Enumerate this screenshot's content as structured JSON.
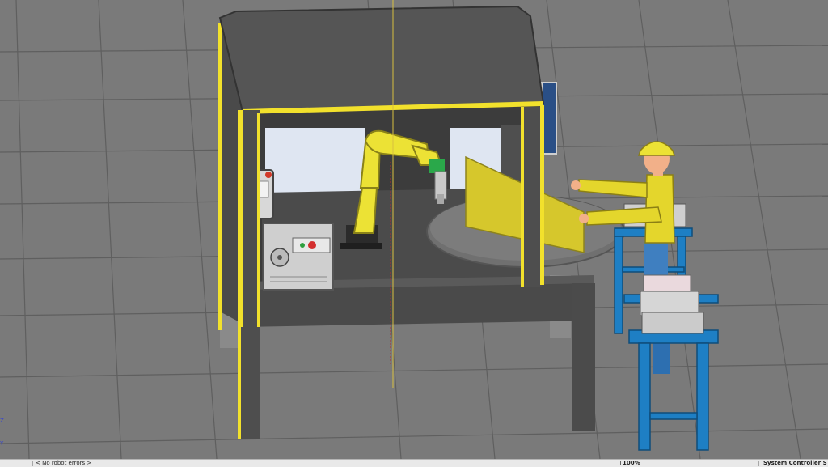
{
  "axes": {
    "z_label": "Z",
    "y_label": "Y"
  },
  "statusbar": {
    "messages": "< No robot errors >",
    "zoom": "100%",
    "controller": "System  Controller  S"
  },
  "colors": {
    "floor": "#7a7a7a",
    "grid": "#5d5d5d",
    "safety_yellow": "#f2e12c",
    "robot_yellow": "#ece235",
    "stand_blue": "#1e7fc4",
    "table_dark": "#4b4b4b",
    "enclosure_roof": "#555555",
    "wall_light": "#dfe6f2"
  },
  "icons": [
    "zoom-icon"
  ]
}
